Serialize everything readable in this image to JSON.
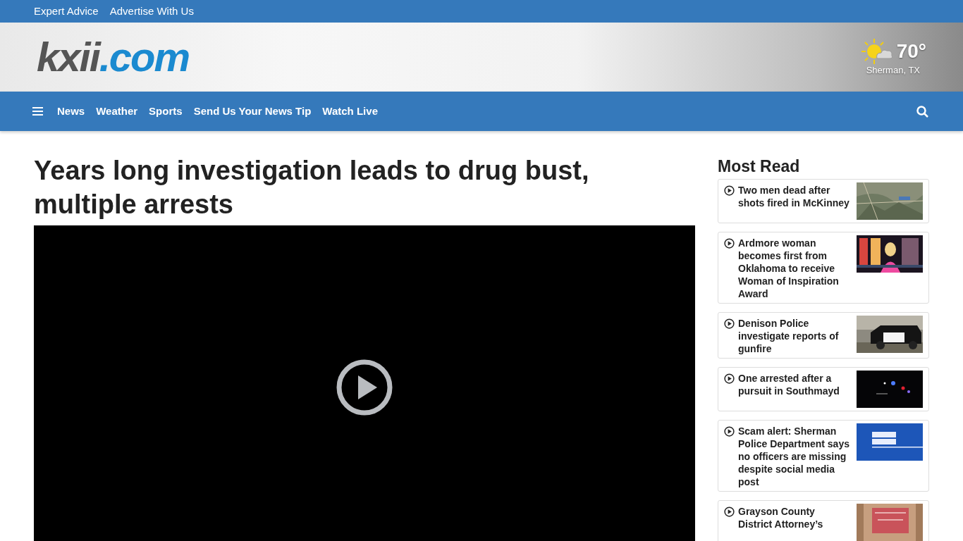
{
  "top_links": [
    "Expert Advice",
    "Advertise With Us"
  ],
  "logo": {
    "name": "kxii",
    "suffix": ".com"
  },
  "weather": {
    "temperature": "70°",
    "location": "Sherman, TX"
  },
  "nav": {
    "items": [
      "News",
      "Weather",
      "Sports",
      "Send Us Your News Tip",
      "Watch Live"
    ]
  },
  "article": {
    "headline": "Years long investigation leads to drug bust, multiple arrests"
  },
  "most_read": {
    "title": "Most Read",
    "items": [
      {
        "headline": "Two men dead after shots fired in McKinney"
      },
      {
        "headline": "Ardmore woman becomes first from Oklahoma to receive Woman of Inspiration Award"
      },
      {
        "headline": "Denison Police investigate reports of gunfire"
      },
      {
        "headline": "One arrested after a pursuit in Southmayd"
      },
      {
        "headline": "Scam alert: Sherman Police Department says no officers are missing despite social media post"
      },
      {
        "headline": "Grayson County District Attorney’s"
      }
    ]
  }
}
